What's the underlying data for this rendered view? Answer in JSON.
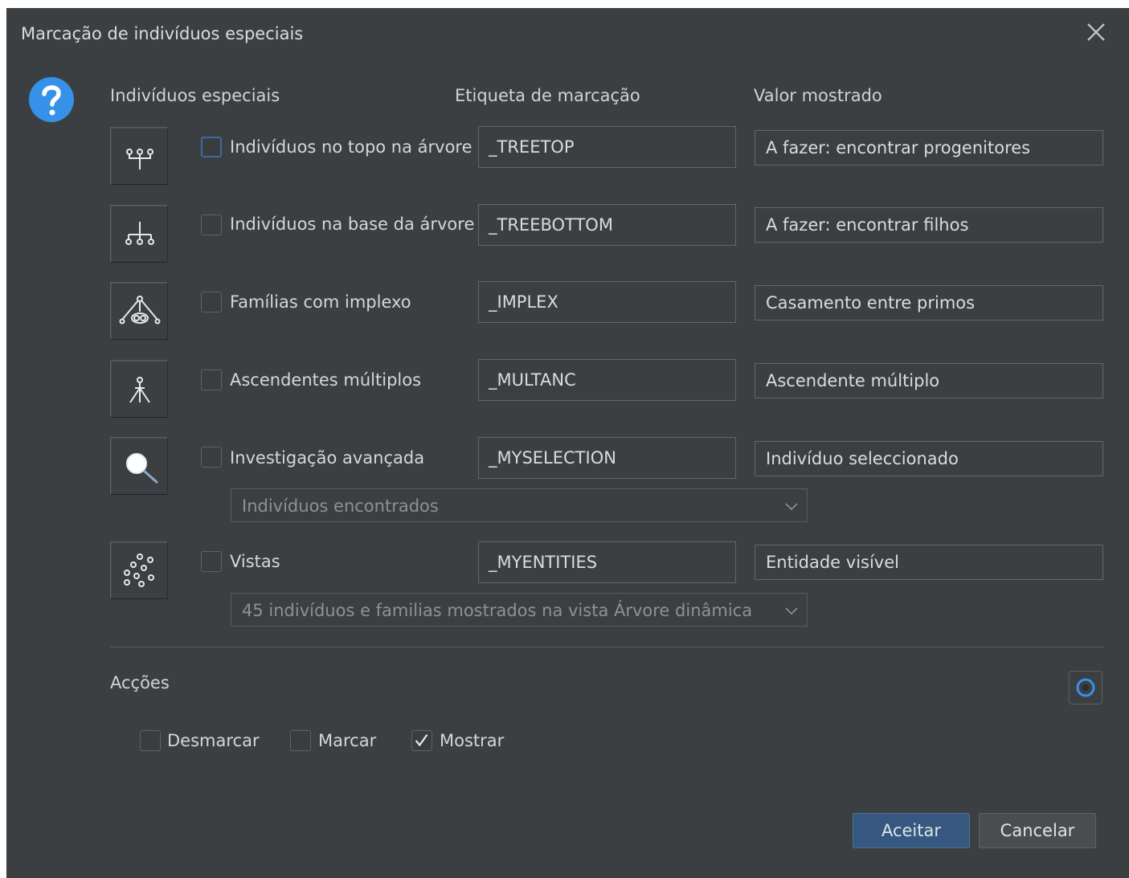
{
  "dialog": {
    "title": "Marcação de indivíduos especiais",
    "columns": {
      "individuals": "Indivíduos especiais",
      "tag": "Etiqueta de marcação",
      "value": "Valor mostrado"
    },
    "rows": [
      {
        "icon": "tree-top-icon",
        "label": "Indivíduos no topo na árvore",
        "tag": "_TREETOP",
        "value": "A fazer: encontrar progenitores",
        "checked": false
      },
      {
        "icon": "tree-bottom-icon",
        "label": "Indivíduos na base da árvore",
        "tag": "_TREEBOTTOM",
        "value": "A fazer: encontrar filhos",
        "checked": false
      },
      {
        "icon": "implex-icon",
        "label": "Famílias com implexo",
        "tag": "_IMPLEX",
        "value": "Casamento entre primos",
        "checked": false
      },
      {
        "icon": "multiple-ancestors-icon",
        "label": "Ascendentes múltiplos",
        "tag": "_MULTANC",
        "value": "Ascendente múltiplo",
        "checked": false
      },
      {
        "icon": "search-icon",
        "label": "Investigação avançada",
        "tag": "_MYSELECTION",
        "value": "Indivíduo seleccionado",
        "checked": false,
        "combo": "Indivíduos encontrados"
      },
      {
        "icon": "views-icon",
        "label": "Vistas",
        "tag": "_MYENTITIES",
        "value": "Entidade visível",
        "checked": false,
        "combo": "45 indivíduos e familias mostrados na vista Árvore dinâmica"
      }
    ],
    "actions": {
      "label": "Acções",
      "unmark": "Desmarcar",
      "mark": "Marcar",
      "show": "Mostrar",
      "show_checked": true
    },
    "buttons": {
      "ok": "Aceitar",
      "cancel": "Cancelar"
    },
    "colors": {
      "background": "#3c3f42",
      "accent": "#3592e8",
      "primary_button": "#365880"
    }
  }
}
